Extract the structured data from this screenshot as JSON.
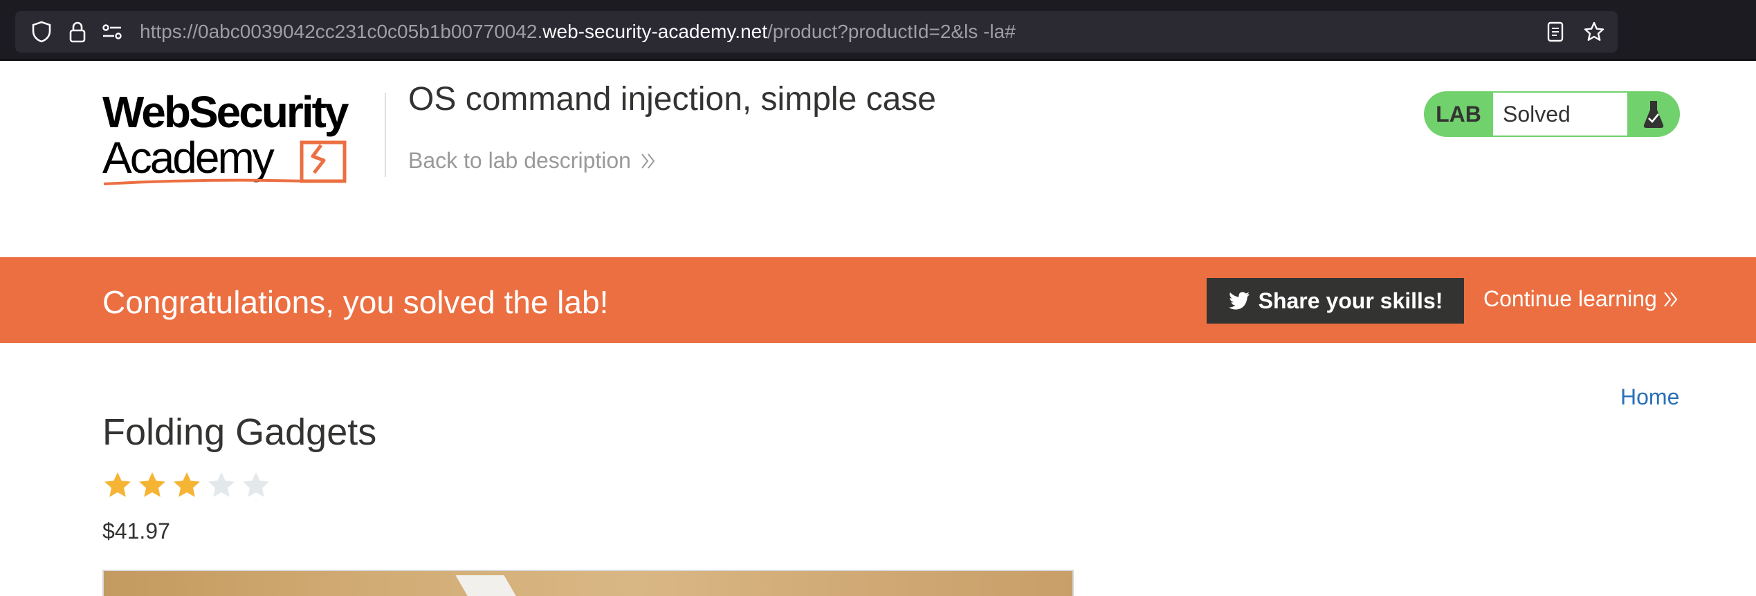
{
  "browser": {
    "url_prefix": "https://0abc0039042cc231c0c05b1b00770042.",
    "url_host": "web-security-academy.net",
    "url_path": "/product?productId=2&ls -la#",
    "icons": [
      "shield-icon",
      "lock-icon",
      "site-settings-icon",
      "reader-view-icon",
      "bookmark-star-icon"
    ]
  },
  "header": {
    "logo_text_line1": "WebSecurity",
    "logo_text_line2": "Academy",
    "lab_title": "OS command injection, simple case",
    "back_link": "Back to lab description",
    "lab_status_label": "LAB",
    "lab_status_value": "Solved"
  },
  "banner": {
    "message": "Congratulations, you solved the lab!",
    "share_button": "Share your skills!",
    "continue_link": "Continue learning"
  },
  "nav": {
    "home": "Home"
  },
  "product": {
    "title": "Folding Gadgets",
    "rating": 3,
    "rating_max": 5,
    "price": "$41.97"
  },
  "colors": {
    "accent_orange": "#ec6f42",
    "lab_green": "#70d16d",
    "link_blue": "#2970b8",
    "star_filled": "#f5b433",
    "star_empty": "#e3e8ea"
  }
}
